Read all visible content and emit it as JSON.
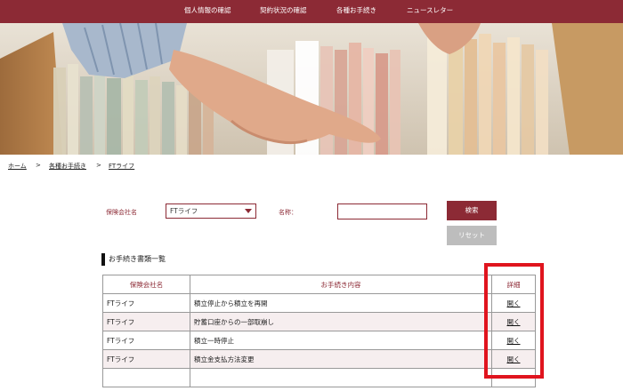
{
  "nav": {
    "items": [
      "個人情報の確認",
      "契約状況の確認",
      "各種お手続き",
      "ニュースレター"
    ]
  },
  "breadcrumb": {
    "home": "ホーム",
    "sep1": ">",
    "procedures": "各種お手続き",
    "sep2": ">",
    "current": "FTライフ"
  },
  "search": {
    "company_label": "保険会社名",
    "company_value": "FTライフ",
    "name_label": "名称：",
    "name_value": "",
    "search_button": "検索",
    "reset_button": "リセット"
  },
  "section": {
    "title": "お手続き書類一覧"
  },
  "table": {
    "headers": [
      "保険会社名",
      "お手続き内容",
      "詳細"
    ],
    "rows": [
      {
        "company": "FTライフ",
        "content": "積立停止から積立を再開",
        "detail": "開く"
      },
      {
        "company": "FTライフ",
        "content": "貯蓄口座からの一部取崩し",
        "detail": "開く"
      },
      {
        "company": "FTライフ",
        "content": "積立一時停止",
        "detail": "開く"
      },
      {
        "company": "FTライフ",
        "content": "積立金支払方法変更",
        "detail": "開く"
      },
      {
        "company": "",
        "content": "",
        "detail": ""
      }
    ]
  },
  "colors": {
    "brand": "#8c2a35",
    "highlight": "#e0141e",
    "row_alt": "#f6eeef"
  }
}
